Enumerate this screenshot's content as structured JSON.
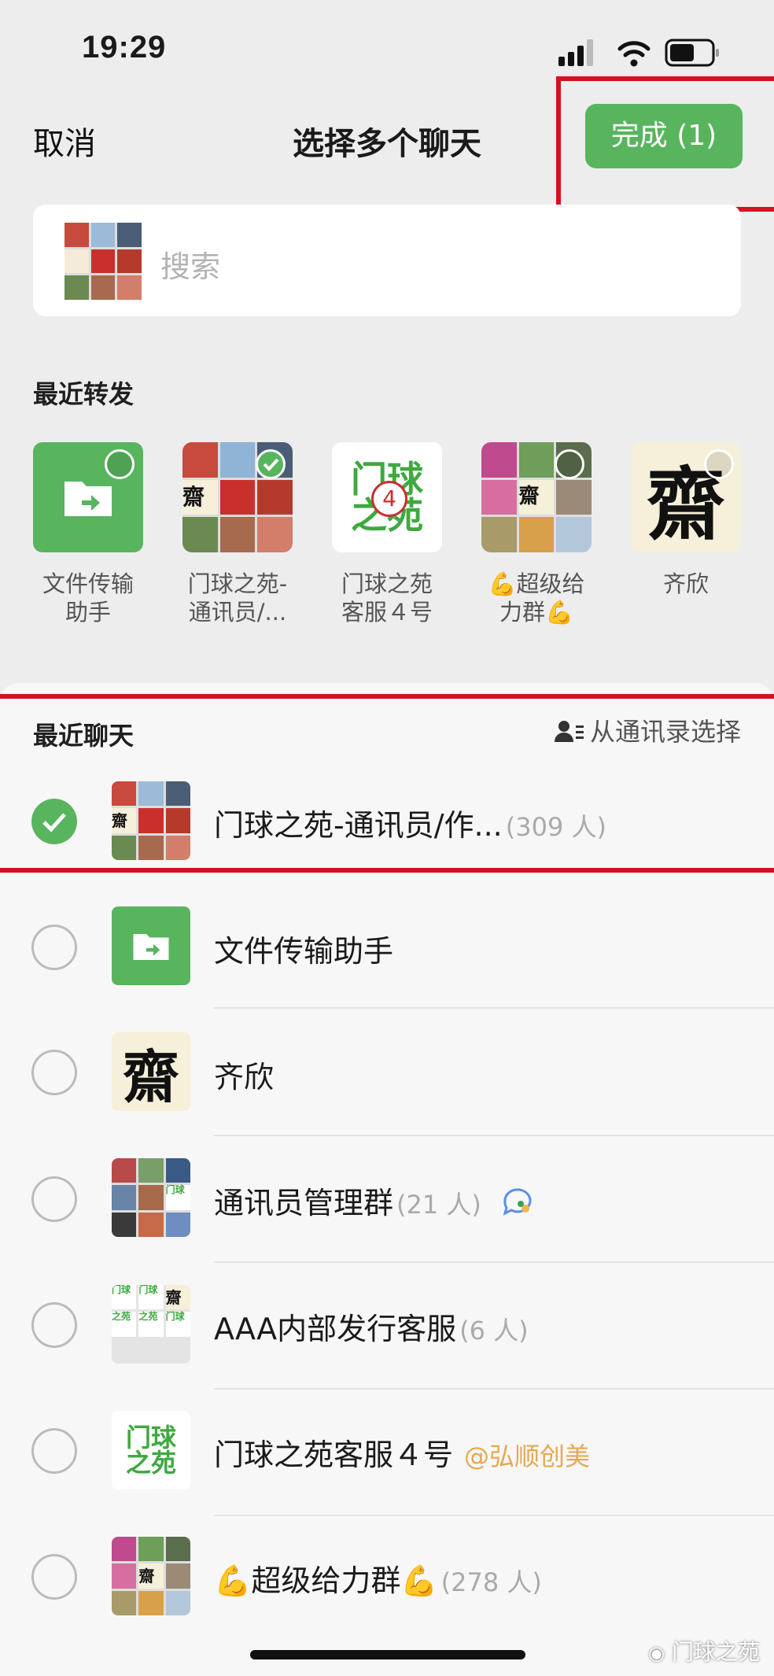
{
  "status_bar": {
    "time": "19:29"
  },
  "nav": {
    "cancel": "取消",
    "title": "选择多个聊天",
    "done": "完成 (1)"
  },
  "search": {
    "placeholder": "搜索"
  },
  "recent_forward": {
    "label": "最近转发",
    "items": [
      {
        "name": "文件传输\n助手",
        "selected": false
      },
      {
        "name": "门球之苑-\n通讯员/...",
        "selected": true
      },
      {
        "name": "门球之苑\n客服４号",
        "selected": false
      },
      {
        "name": "💪超级给\n力群💪",
        "selected": false
      },
      {
        "name": "齐欣",
        "selected": false
      }
    ]
  },
  "recent_chats": {
    "label": "最近聊天",
    "from_contacts": "从通讯录选择",
    "rows": [
      {
        "name": "门球之苑-通讯员/作...",
        "count": "(309 人)",
        "selected": true
      },
      {
        "name": "文件传输助手",
        "count": "",
        "selected": false
      },
      {
        "name": "齐欣",
        "count": "",
        "selected": false
      },
      {
        "name": "通讯员管理群",
        "count": "(21 人)",
        "selected": false
      },
      {
        "name": "AAA内部发行客服",
        "count": "(6 人)",
        "selected": false
      },
      {
        "name": "门球之苑客服４号",
        "count": "",
        "sub": "@弘顺创美",
        "selected": false
      },
      {
        "name": "💪超级给力群💪",
        "count": "(278 人)",
        "selected": false
      }
    ]
  },
  "avatar_text": {
    "calligraphy": "齋",
    "mqzy_1": "门球",
    "mqzy_2": "之苑",
    "mqzy_num": "4"
  },
  "watermark": "门球之苑",
  "colors": {
    "accent_green": "#58b55e",
    "highlight_red": "#d4111f"
  }
}
